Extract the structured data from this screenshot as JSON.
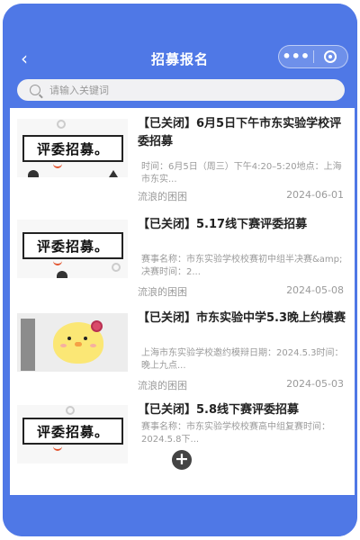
{
  "header": {
    "title": "招募报名",
    "back_icon": "chevron-left-icon",
    "more_icon": "more-dots-icon",
    "close_icon": "target-circle-icon"
  },
  "search": {
    "placeholder": "请输入关键词"
  },
  "items": [
    {
      "title": "【已关闭】6月5日下午市东实验学校评委招募",
      "desc_lines": [
        "时间：6月5日（周三）下午4:20–5:20地点：上海市东实..."
      ],
      "author": "流浪的困困",
      "date": "2024-06-01",
      "thumb_text": "评委招募。"
    },
    {
      "title": "【已关闭】5.17线下赛评委招募",
      "desc_lines": [
        "赛事名称：市东实验学校校赛初中组半决赛&amp;决赛时间：2..."
      ],
      "author": "流浪的困困",
      "date": "2024-05-08",
      "thumb_text": "评委招募。"
    },
    {
      "title": "【已关闭】市东实验中学5.3晚上约模赛",
      "desc_lines": [
        "上海市东实验学校邀约模辩日期：2024.5.3时间：晚上九点..."
      ],
      "author": "流浪的困困",
      "date": "2024-05-03",
      "thumb_text": ""
    },
    {
      "title": "【已关闭】5.8线下赛评委招募",
      "desc_lines": [
        "赛事名称：市东实验学校校赛高中组复赛时间：2024.5.8下..."
      ],
      "author": "",
      "date": "",
      "thumb_text": "评委招募。"
    }
  ],
  "fab": {
    "icon": "plus-circle-icon",
    "label": "+"
  }
}
